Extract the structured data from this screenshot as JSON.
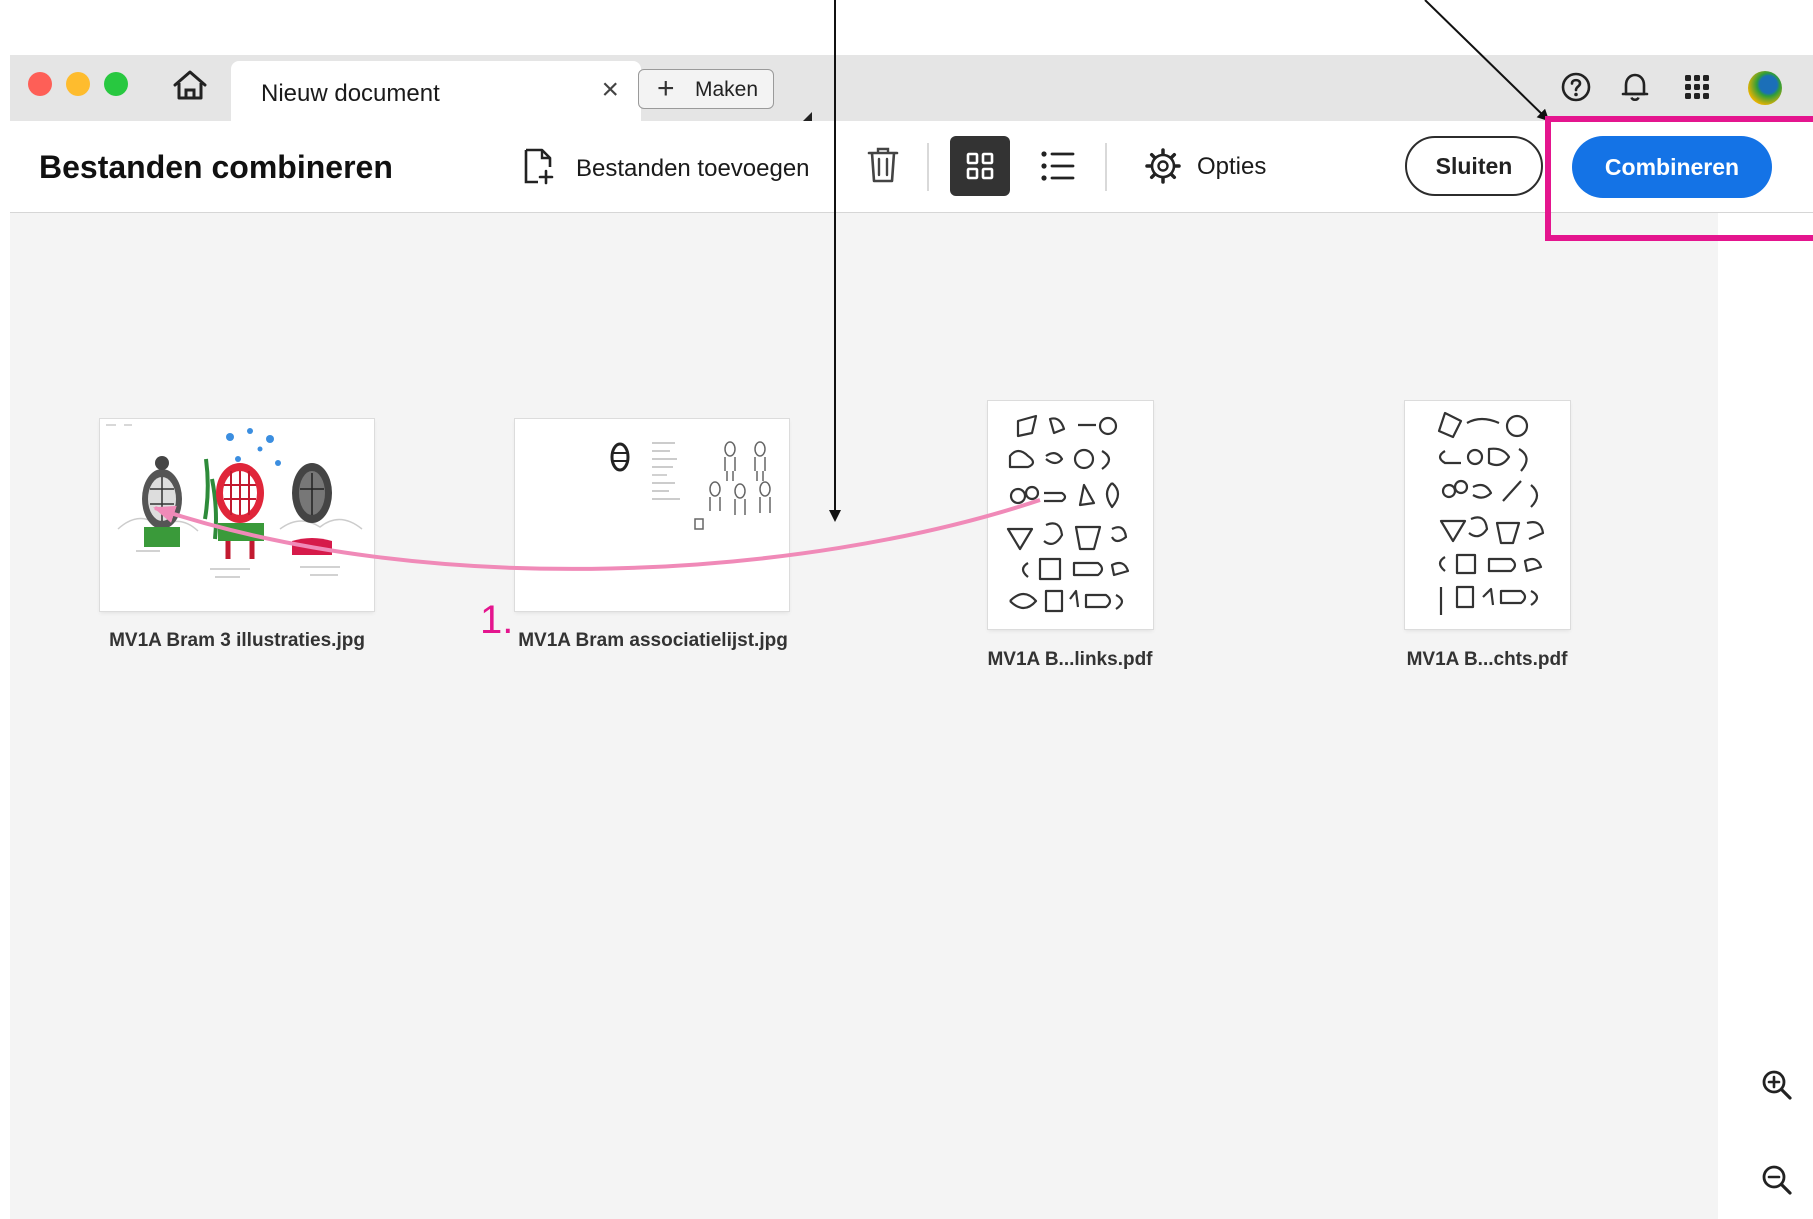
{
  "window": {
    "tab_title": "Nieuw document",
    "tab_close": "×",
    "new_button_label": "Maken",
    "new_button_glyph": "+"
  },
  "titlebar_icons": [
    "home-icon",
    "help-icon",
    "bell-icon",
    "apps-grid-icon",
    "avatar"
  ],
  "toolbar": {
    "title": "Bestanden combineren",
    "add_files_label": "Bestanden toevoegen",
    "options_label": "Opties",
    "close_label": "Sluiten",
    "combine_label": "Combineren",
    "view_mode": "grid"
  },
  "files": [
    {
      "name": "MV1A Bram 3 illustraties.jpg",
      "type": "jpg"
    },
    {
      "name": "MV1A Bram associatielijst.jpg",
      "type": "jpg"
    },
    {
      "name": "MV1A B...links.pdf",
      "type": "pdf"
    },
    {
      "name": "MV1A B...chts.pdf",
      "type": "pdf"
    }
  ],
  "annotation": {
    "step_label": "1."
  },
  "colors": {
    "accent": "#1473e6",
    "annotation": "#e4158e",
    "arrow": "#f08ab8"
  }
}
